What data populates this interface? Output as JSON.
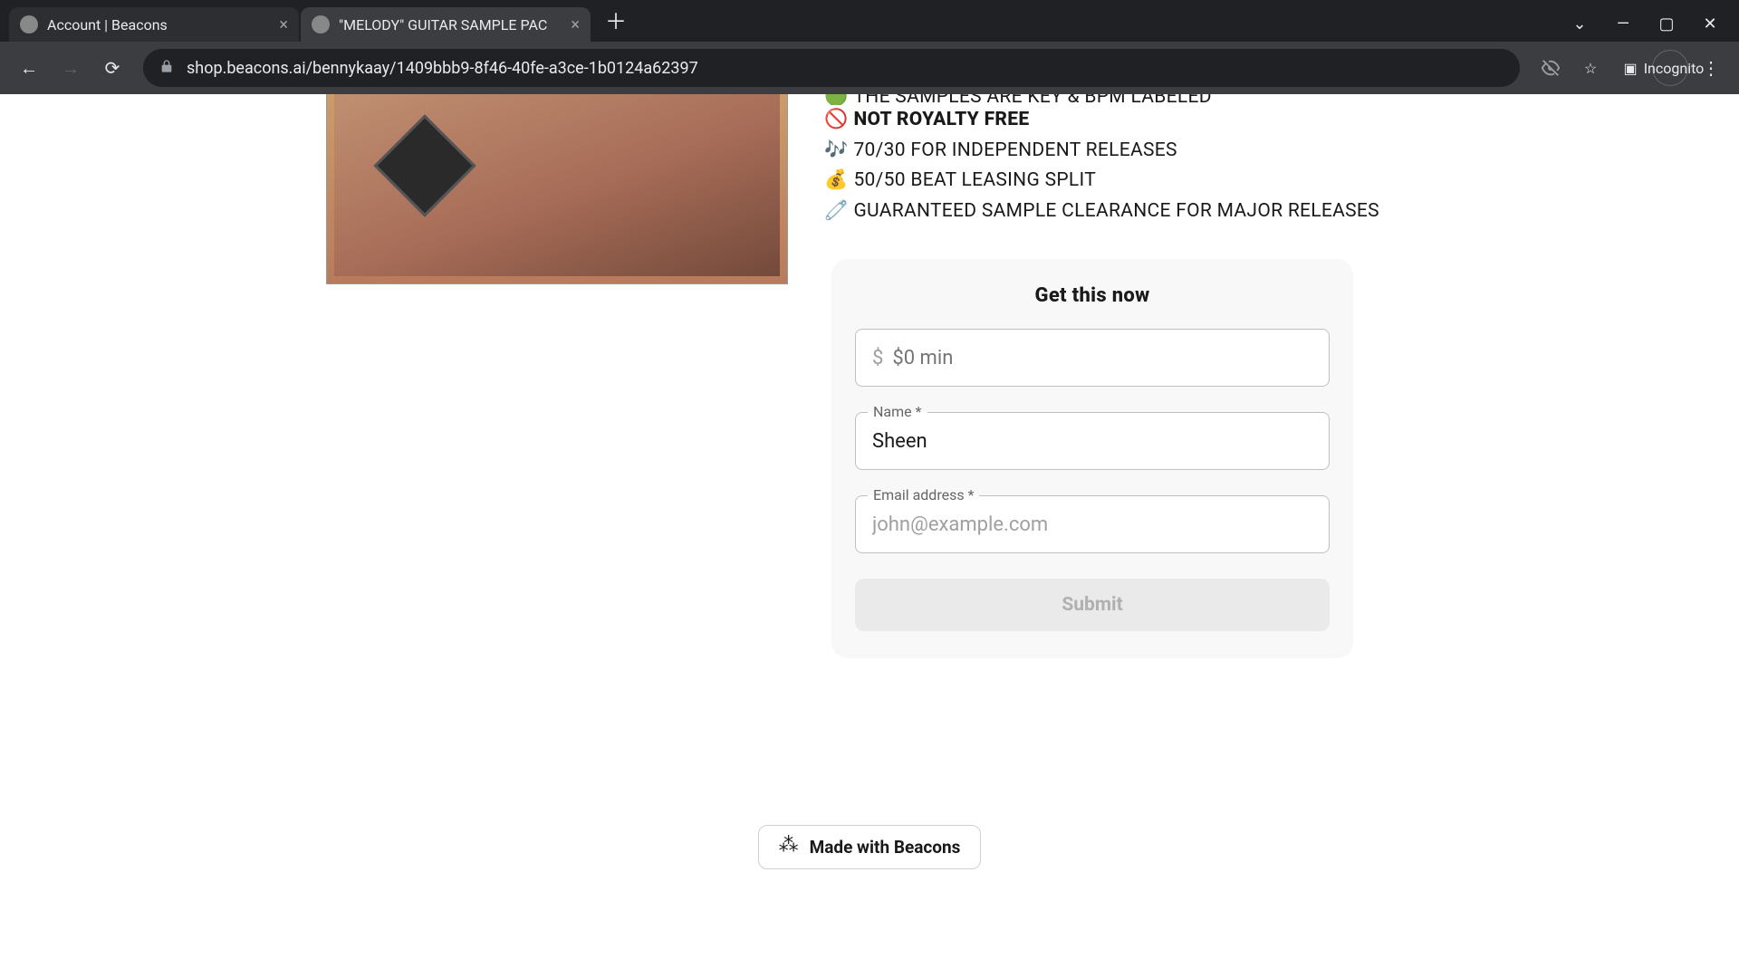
{
  "browser": {
    "tabs": [
      {
        "title": "Account | Beacons"
      },
      {
        "title": "\"MELODY\" GUITAR SAMPLE PAC"
      }
    ],
    "url": "shop.beacons.ai/bennykaay/1409bbb9-8f46-40fe-a3ce-1b0124a62397",
    "incognito_label": "Incognito"
  },
  "product": {
    "bullets": [
      {
        "emoji": "🟢",
        "text": "THE SAMPLES ARE KEY & BPM LABELED",
        "partial": true
      },
      {
        "emoji": "🚫",
        "text": "NOT ROYALTY FREE",
        "bold": true
      },
      {
        "emoji": "🎶",
        "text": "70/30 FOR INDEPENDENT RELEASES"
      },
      {
        "emoji": "💰",
        "text": "50/50 BEAT LEASING SPLIT"
      },
      {
        "emoji": "🧷",
        "text": "GUARANTEED SAMPLE CLEARANCE FOR MAJOR RELEASES"
      }
    ]
  },
  "form": {
    "title": "Get this now",
    "price_prefix": "$",
    "price_placeholder": "$0 min",
    "name_label": "Name *",
    "name_value": "Sheen",
    "email_label": "Email address *",
    "email_placeholder": "john@example.com",
    "submit_label": "Submit"
  },
  "footer": {
    "label": "Made with Beacons"
  }
}
